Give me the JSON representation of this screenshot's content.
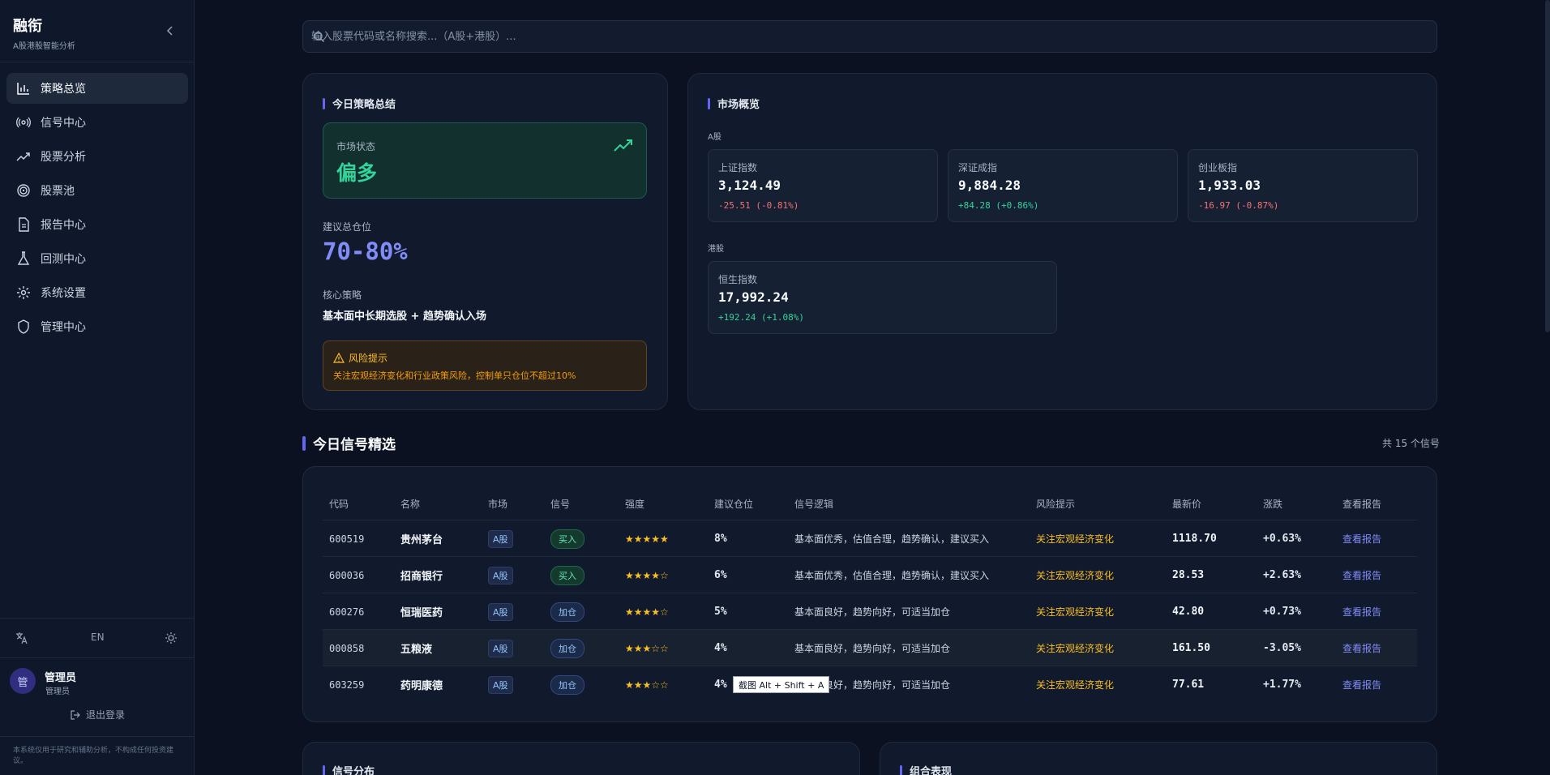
{
  "sidebar": {
    "brand_title": "融衔",
    "brand_subtitle": "A股港股智能分析",
    "items": [
      {
        "label": "策略总览",
        "icon": "bar-chart-icon"
      },
      {
        "label": "信号中心",
        "icon": "radio-signal-icon"
      },
      {
        "label": "股票分析",
        "icon": "trending-up-icon"
      },
      {
        "label": "股票池",
        "icon": "target-icon"
      },
      {
        "label": "报告中心",
        "icon": "document-icon"
      },
      {
        "label": "回测中心",
        "icon": "flask-icon"
      },
      {
        "label": "系统设置",
        "icon": "gear-icon"
      },
      {
        "label": "管理中心",
        "icon": "shield-icon"
      }
    ],
    "active_index": 0,
    "language_label": "EN",
    "user": {
      "avatar_text": "管",
      "name": "管理员",
      "role": "管理员"
    },
    "logout_label": "退出登录",
    "disclaimer": "本系统仅用于研究和辅助分析，不构成任何投资建议。"
  },
  "search": {
    "placeholder": "输入股票代码或名称搜索...（A股+港股）..."
  },
  "summary": {
    "title": "今日策略总结",
    "market_state_label": "市场状态",
    "market_state_value": "偏多",
    "position_label": "建议总仓位",
    "position_value": "70-80%",
    "strategy_label": "核心策略",
    "strategy_value": "基本面中长期选股 + 趋势确认入场",
    "risk_title": "风险提示",
    "risk_text": "关注宏观经济变化和行业政策风险，控制单只仓位不超过10%"
  },
  "market": {
    "title": "市场概览",
    "a_label": "A股",
    "hk_label": "港股",
    "a_indices": [
      {
        "name": "上证指数",
        "value": "3,124.49",
        "change": "-25.51 (-0.81%)",
        "dir": "down"
      },
      {
        "name": "深证成指",
        "value": "9,884.28",
        "change": "+84.28 (+0.86%)",
        "dir": "up"
      },
      {
        "name": "创业板指",
        "value": "1,933.03",
        "change": "-16.97 (-0.87%)",
        "dir": "down"
      }
    ],
    "hk_indices": [
      {
        "name": "恒生指数",
        "value": "17,992.24",
        "change": "+192.24 (+1.08%)",
        "dir": "up"
      }
    ]
  },
  "signals": {
    "title": "今日信号精选",
    "count_text": "共 15 个信号",
    "headers": [
      "代码",
      "名称",
      "市场",
      "信号",
      "强度",
      "建议仓位",
      "信号逻辑",
      "风险提示",
      "最新价",
      "涨跌",
      "查看报告"
    ],
    "rows": [
      {
        "code": "600519",
        "name": "贵州茅台",
        "market": "A股",
        "signal": "买入",
        "signal_type": "buy",
        "stars": "★★★★★",
        "weight": "8%",
        "logic": "基本面优秀，估值合理，趋势确认，建议买入",
        "risk": "关注宏观经济变化",
        "price": "1118.70",
        "change": "+0.63%",
        "dir": "up",
        "report": "查看报告"
      },
      {
        "code": "600036",
        "name": "招商银行",
        "market": "A股",
        "signal": "买入",
        "signal_type": "buy",
        "stars": "★★★★☆",
        "weight": "6%",
        "logic": "基本面优秀，估值合理，趋势确认，建议买入",
        "risk": "关注宏观经济变化",
        "price": "28.53",
        "change": "+2.63%",
        "dir": "up",
        "report": "查看报告"
      },
      {
        "code": "600276",
        "name": "恒瑞医药",
        "market": "A股",
        "signal": "加仓",
        "signal_type": "add",
        "stars": "★★★★☆",
        "weight": "5%",
        "logic": "基本面良好，趋势向好，可适当加仓",
        "risk": "关注宏观经济变化",
        "price": "42.80",
        "change": "+0.73%",
        "dir": "up",
        "report": "查看报告"
      },
      {
        "code": "000858",
        "name": "五粮液",
        "market": "A股",
        "signal": "加仓",
        "signal_type": "add",
        "stars": "★★★☆☆",
        "weight": "4%",
        "logic": "基本面良好，趋势向好，可适当加仓",
        "risk": "关注宏观经济变化",
        "price": "161.50",
        "change": "-3.05%",
        "dir": "down",
        "report": "查看报告"
      },
      {
        "code": "603259",
        "name": "药明康德",
        "market": "A股",
        "signal": "加仓",
        "signal_type": "add",
        "stars": "★★★☆☆",
        "weight": "4%",
        "logic": "基本面良好，趋势向好，可适当加仓",
        "risk": "关注宏观经济变化",
        "price": "77.61",
        "change": "+1.77%",
        "dir": "up",
        "report": "查看报告"
      }
    ]
  },
  "tooltip": "截图 Alt + Shift + A",
  "bottom": {
    "left_title": "信号分布",
    "right_title": "组合表现"
  },
  "colors": {
    "accent": "#6366f1",
    "up": "#34d399",
    "down": "#f87171",
    "warning": "#fbbf24",
    "background": "#0b1120"
  }
}
